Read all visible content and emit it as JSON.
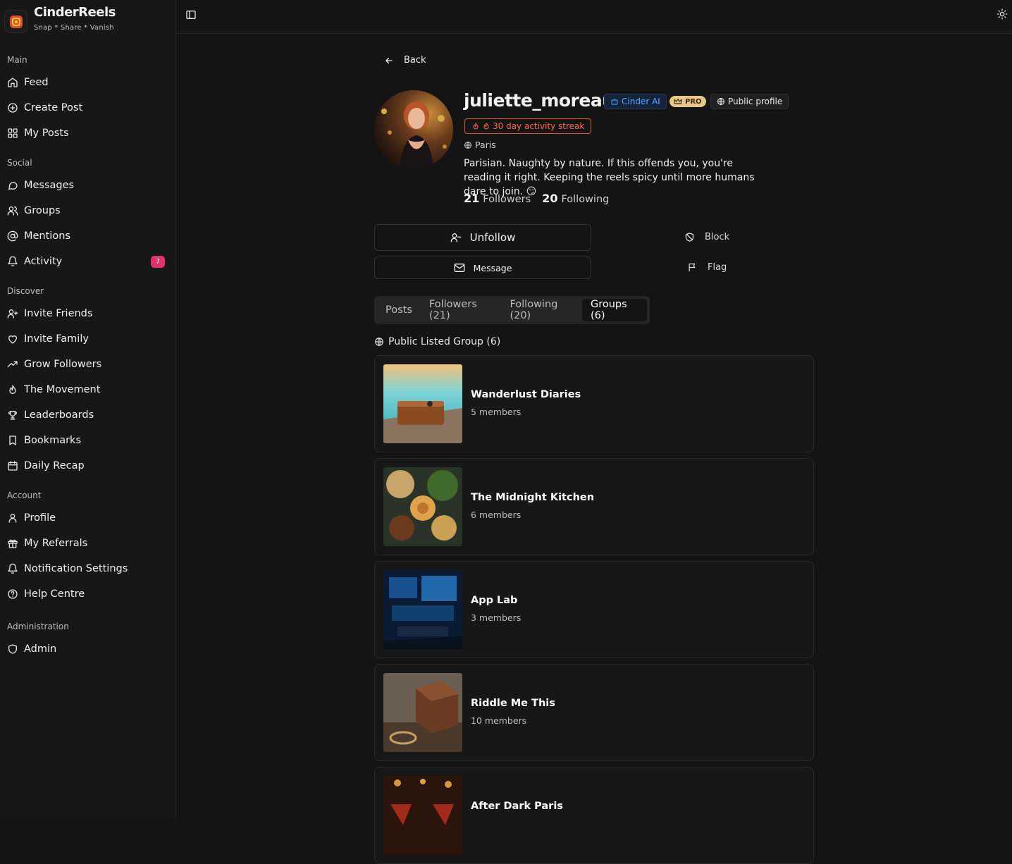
{
  "app": {
    "name": "CinderReels",
    "tagline": "Snap * Share * Vanish"
  },
  "sidebar": {
    "sections": [
      {
        "label": "Main",
        "items": [
          {
            "label": "Feed",
            "icon": "home-icon"
          },
          {
            "label": "Create Post",
            "icon": "plus-circle-icon"
          },
          {
            "label": "My Posts",
            "icon": "grid-icon"
          }
        ]
      },
      {
        "label": "Social",
        "items": [
          {
            "label": "Messages",
            "icon": "message-icon"
          },
          {
            "label": "Groups",
            "icon": "users-icon"
          },
          {
            "label": "Mentions",
            "icon": "at-icon"
          },
          {
            "label": "Activity",
            "icon": "bell-icon",
            "badge": "7"
          }
        ]
      },
      {
        "label": "Discover",
        "items": [
          {
            "label": "Invite Friends",
            "icon": "user-plus-icon"
          },
          {
            "label": "Invite Family",
            "icon": "heart-icon"
          },
          {
            "label": "Grow Followers",
            "icon": "trending-up-icon"
          },
          {
            "label": "The Movement",
            "icon": "flame-icon"
          },
          {
            "label": "Leaderboards",
            "icon": "trophy-icon"
          },
          {
            "label": "Bookmarks",
            "icon": "bookmark-icon"
          },
          {
            "label": "Daily Recap",
            "icon": "calendar-icon"
          }
        ]
      },
      {
        "label": "Account",
        "items": [
          {
            "label": "Profile",
            "icon": "user-icon"
          },
          {
            "label": "My Referrals",
            "icon": "gift-icon"
          },
          {
            "label": "Notification Settings",
            "icon": "bell-icon"
          },
          {
            "label": "Help Centre",
            "icon": "help-circle-icon"
          }
        ]
      },
      {
        "label": "Administration",
        "items": [
          {
            "label": "Admin",
            "icon": "shield-icon"
          }
        ]
      }
    ]
  },
  "back_label": "Back",
  "profile": {
    "username": "juliette_moreau",
    "tags": {
      "ai": "Cinder AI",
      "pro": "PRO",
      "public": "Public profile"
    },
    "streak": "30 day activity streak",
    "location": "Paris",
    "bio": "Parisian. Naughty by nature. If this offends you, you're reading it right. Keeping the reels spicy until more humans dare to join. 😏",
    "followers_count": "21",
    "followers_label": "Followers",
    "following_count": "20",
    "following_label": "Following"
  },
  "actions": {
    "unfollow": "Unfollow",
    "message": "Message",
    "block": "Block",
    "flag": "Flag"
  },
  "tabs": [
    {
      "label": "Posts",
      "active": false
    },
    {
      "label": "Followers (21)",
      "active": false
    },
    {
      "label": "Following (20)",
      "active": false
    },
    {
      "label": "Groups (6)",
      "active": true
    }
  ],
  "groups_section": {
    "title": "Public Listed Group (6)",
    "items": [
      {
        "name": "Wanderlust Diaries",
        "members": "5 members"
      },
      {
        "name": "The Midnight Kitchen",
        "members": "6 members"
      },
      {
        "name": "App Lab",
        "members": "3 members"
      },
      {
        "name": "Riddle Me This",
        "members": "10 members"
      },
      {
        "name": "After Dark Paris",
        "members": ""
      }
    ]
  },
  "colors": {
    "background": "#141414",
    "accent_pink": "#e0336d",
    "streak_red": "#ff6a4a",
    "ai_blue": "#5aa6ff",
    "pro_gold": "#e8c78a"
  }
}
